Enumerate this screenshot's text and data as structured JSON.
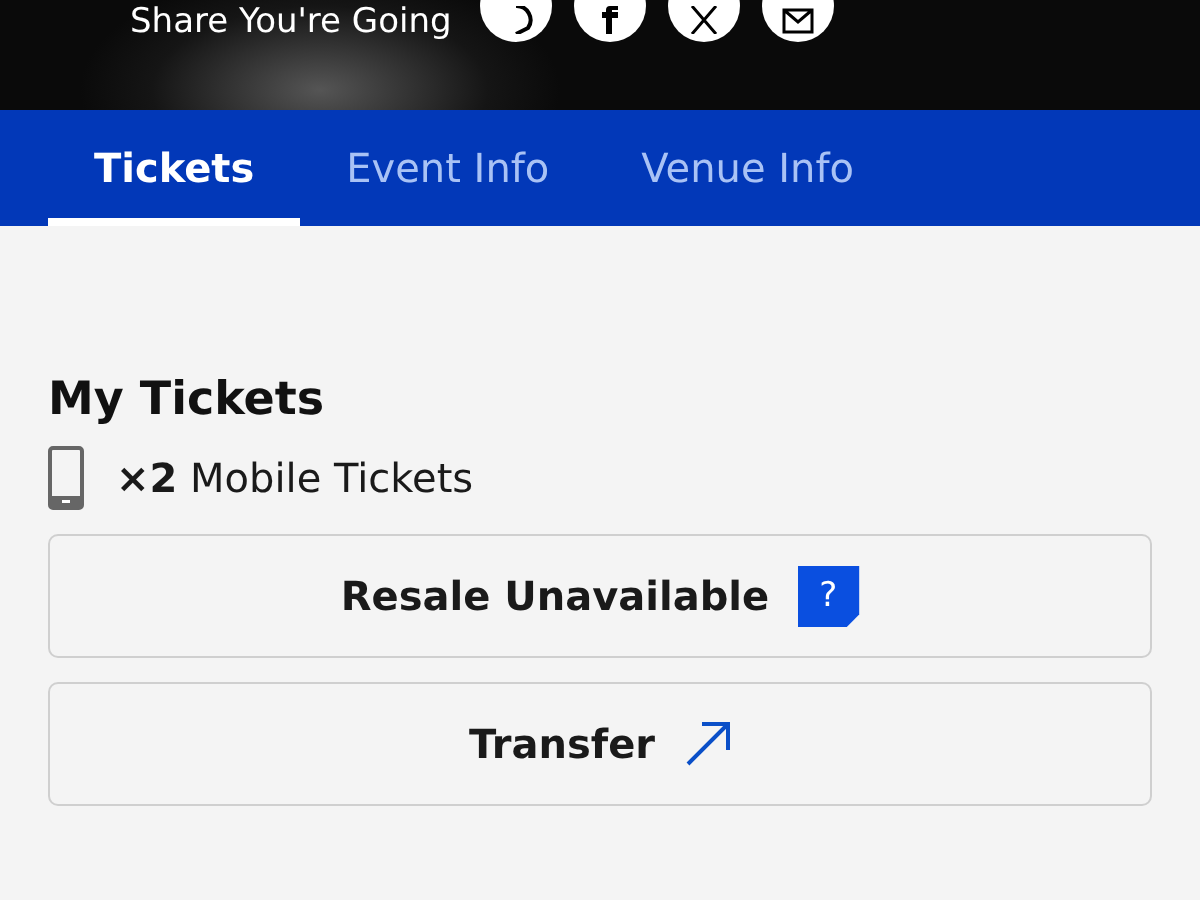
{
  "share": {
    "label": "Share You're Going"
  },
  "tabs": [
    {
      "label": "Tickets",
      "selected": true
    },
    {
      "label": "Event Info",
      "selected": false
    },
    {
      "label": "Venue Info",
      "selected": false
    }
  ],
  "section": {
    "title": "My Tickets",
    "ticket_count": "**×2** Mobile Tickets"
  },
  "buttons": [
    {
      "kind": "help",
      "label": "Resale Unavailable",
      "badge": "?"
    },
    {
      "kind": "link",
      "label": "Transfer"
    }
  ]
}
